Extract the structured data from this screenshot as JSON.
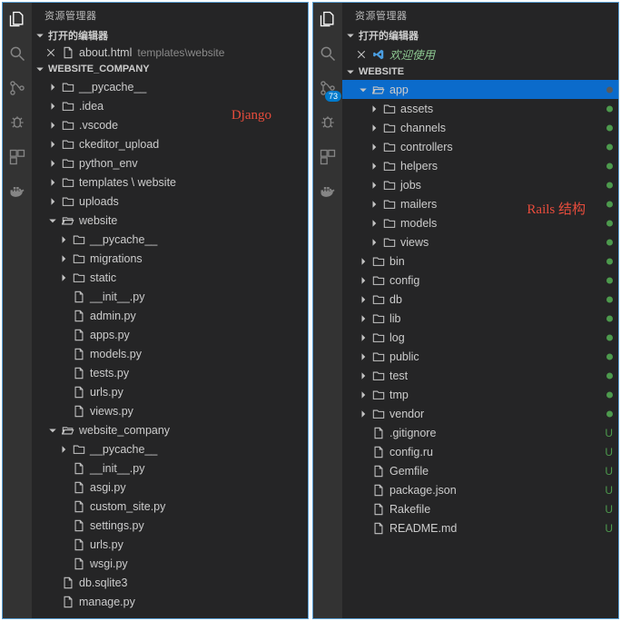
{
  "left": {
    "title": "资源管理器",
    "open_editors_label": "打开的编辑器",
    "open_editor": {
      "name": "about.html",
      "path": "templates\\website"
    },
    "workspace_label": "WEBSITE_COMPANY",
    "overlay": "Django",
    "tree": {
      "top_folders": [
        "__pycache__",
        ".idea",
        ".vscode",
        "ckeditor_upload",
        "python_env",
        "templates \\ website",
        "uploads"
      ],
      "website_folder": "website",
      "website_children_folders": [
        "__pycache__",
        "migrations",
        "static"
      ],
      "website_children_files": [
        "__init__.py",
        "admin.py",
        "apps.py",
        "models.py",
        "tests.py",
        "urls.py",
        "views.py"
      ],
      "website_company_folder": "website_company",
      "wc_children_folders": [
        "__pycache__"
      ],
      "wc_children_files": [
        "__init__.py",
        "asgi.py",
        "custom_site.py",
        "settings.py",
        "urls.py",
        "wsgi.py"
      ],
      "root_files": [
        "db.sqlite3",
        "manage.py"
      ]
    }
  },
  "right": {
    "title": "资源管理器",
    "open_editors_label": "打开的编辑器",
    "open_editor": {
      "name": "欢迎使用"
    },
    "workspace_label": "WEBSITE",
    "scm_badge": "73",
    "overlay": "Rails 结构",
    "tree": {
      "app_folder": "app",
      "app_children": [
        "assets",
        "channels",
        "controllers",
        "helpers",
        "jobs",
        "mailers",
        "models",
        "views"
      ],
      "root_folders": [
        "bin",
        "config",
        "db",
        "lib",
        "log",
        "public",
        "test",
        "tmp",
        "vendor"
      ],
      "root_files": [
        ".gitignore",
        "config.ru",
        "Gemfile",
        "package.json",
        "Rakefile",
        "README.md"
      ]
    }
  }
}
